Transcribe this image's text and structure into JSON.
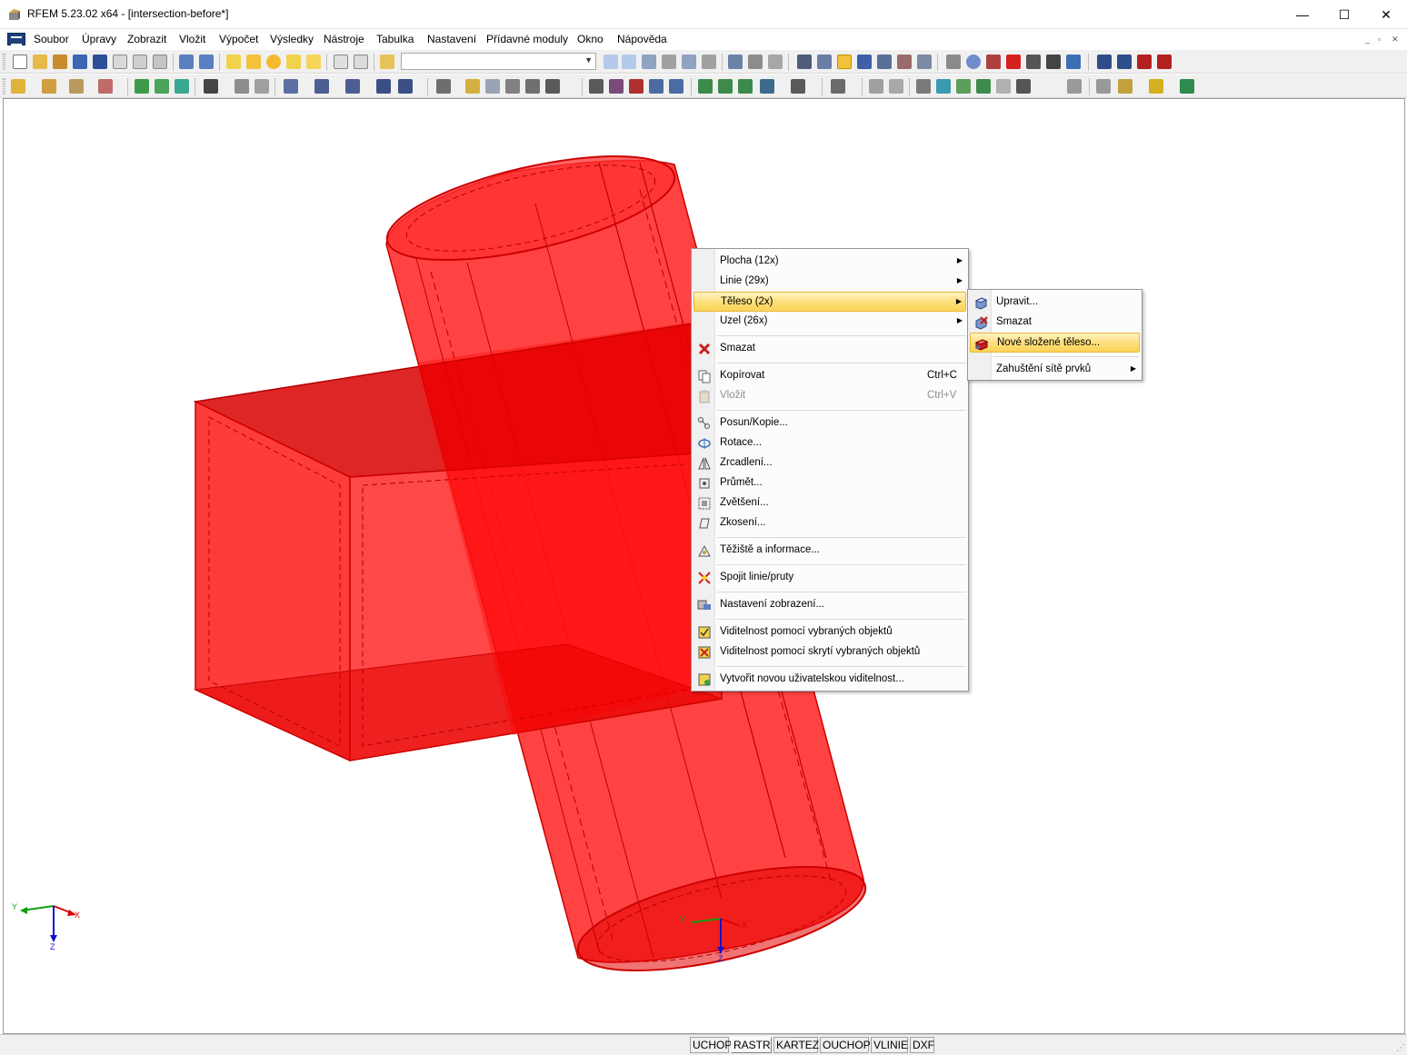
{
  "window": {
    "title": "RFEM 5.23.02 x64 - [intersection-before*]",
    "minimize": "—",
    "maximize": "☐",
    "close": "✕"
  },
  "menu": [
    "Soubor",
    "Úpravy",
    "Zobrazit",
    "Vložit",
    "Výpočet",
    "Výsledky",
    "Nástroje",
    "Tabulka",
    "Nastavení",
    "Přídavné moduly",
    "Okno",
    "Nápověda"
  ],
  "mdi_controls": {
    "minimize": "_",
    "restore": "▫",
    "close": "✕"
  },
  "toolbar": {
    "combo_value": ""
  },
  "context_menu": {
    "items": [
      {
        "label": "Plocha (12x)",
        "submenu": true,
        "icon": "none"
      },
      {
        "label": "Linie (29x)",
        "submenu": true,
        "icon": "none"
      },
      {
        "label": "Těleso (2x)",
        "submenu": true,
        "icon": "none",
        "highlighted": true
      },
      {
        "label": "Uzel (26x)",
        "submenu": true,
        "icon": "none"
      },
      {
        "label": "Smazat",
        "icon": "delete-icon"
      },
      {
        "label": "Kopírovat",
        "shortcut": "Ctrl+C",
        "icon": "copy-icon"
      },
      {
        "label": "Vložit",
        "shortcut": "Ctrl+V",
        "icon": "paste-icon",
        "disabled": true
      },
      {
        "label": "Posun/Kopie...",
        "icon": "move-copy-icon"
      },
      {
        "label": "Rotace...",
        "icon": "rotate-icon"
      },
      {
        "label": "Zrcadlení...",
        "icon": "mirror-icon"
      },
      {
        "label": "Průmět...",
        "icon": "project-icon"
      },
      {
        "label": "Zvětšení...",
        "icon": "scale-icon"
      },
      {
        "label": "Zkosení...",
        "icon": "shear-icon"
      },
      {
        "label": "Těžiště a informace...",
        "icon": "centroid-icon"
      },
      {
        "label": "Spojit linie/pruty",
        "icon": "connect-lines-icon"
      },
      {
        "label": "Nastavení zobrazení...",
        "icon": "display-settings-icon"
      },
      {
        "label": "Viditelnost pomocí vybraných objektů",
        "icon": "visibility-selected-icon"
      },
      {
        "label": "Viditelnost pomocí skrytí vybraných objektů",
        "icon": "visibility-hide-icon"
      },
      {
        "label": "Vytvořit novou uživatelskou viditelnost...",
        "icon": "new-visibility-icon"
      }
    ]
  },
  "submenu": {
    "items": [
      {
        "label": "Upravit...",
        "icon": "edit-solid-icon"
      },
      {
        "label": "Smazat",
        "icon": "delete-solid-icon"
      },
      {
        "label": "Nové složené těleso...",
        "icon": "new-composite-solid-icon",
        "highlighted": true
      },
      {
        "label": "Zahuštění sítě prvků",
        "submenu": true,
        "icon": "none"
      }
    ]
  },
  "axes": {
    "global": {
      "x": "X",
      "y": "Y",
      "z": "Z"
    },
    "local": {
      "x": "X",
      "y": "Y",
      "z": "Z"
    }
  },
  "statusbar": {
    "buttons": [
      {
        "label": "UCHOP",
        "active": false
      },
      {
        "label": "RASTR",
        "active": true
      },
      {
        "label": "KARTEZ",
        "active": false
      },
      {
        "label": "OUCHOP",
        "active": false
      },
      {
        "label": "VLINIE",
        "active": false
      },
      {
        "label": "DXF",
        "active": false
      }
    ]
  },
  "colors": {
    "solid": "#ff1a1a",
    "solid_dark": "#d40000",
    "highlight": "#fbd355",
    "axis_x": "#e00000",
    "axis_y": "#11a011",
    "axis_z": "#1010d0"
  }
}
